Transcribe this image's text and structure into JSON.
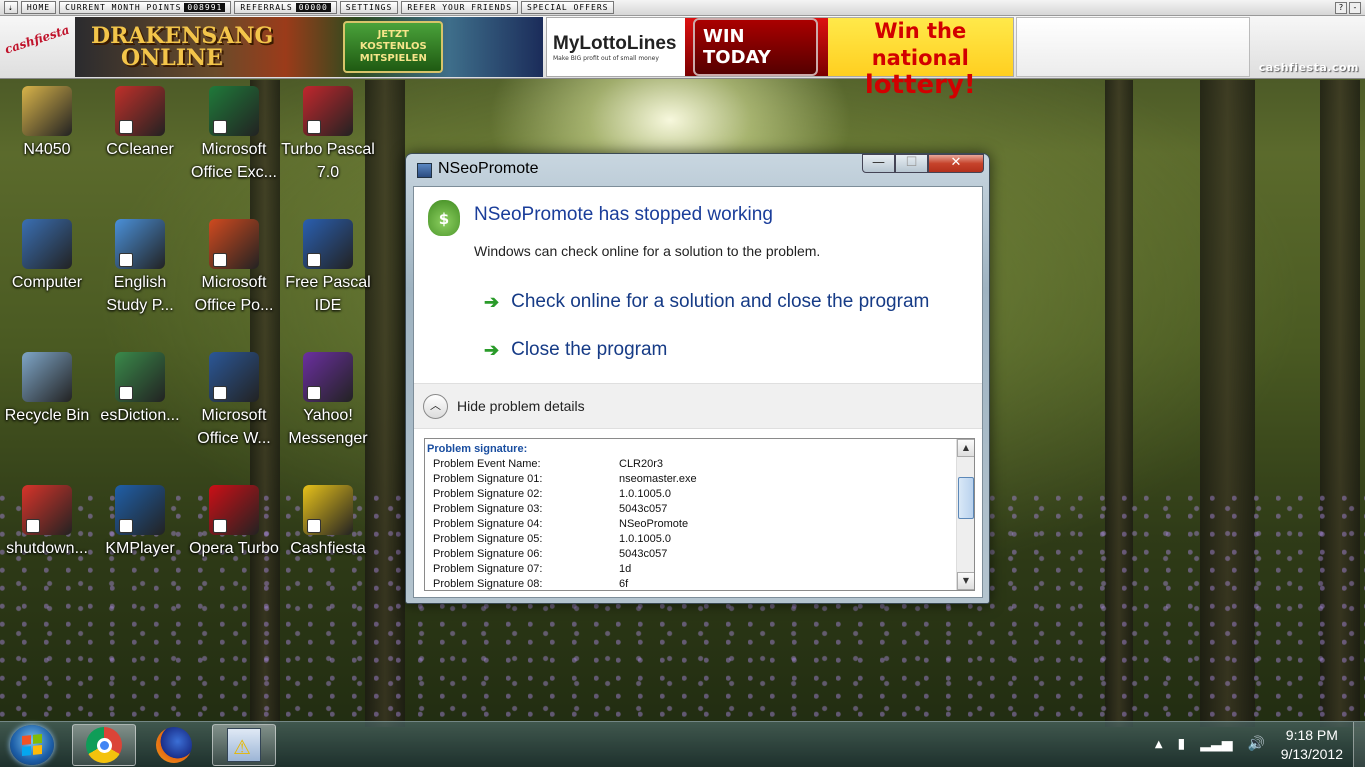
{
  "toolbar": {
    "home": "HOME",
    "month_points_label": "CURRENT MONTH POINTS",
    "month_points_value": "008991",
    "referrals_label": "REFERRALS",
    "referrals_value": "00000",
    "settings": "SETTINGS",
    "refer_friends": "REFER YOUR FRIENDS",
    "special_offers": "SPECIAL OFFERS",
    "help": "?",
    "close": "-"
  },
  "banner": {
    "logo_text": "cashfiesta",
    "ad1_title_line1": "DRAKENSANG",
    "ad1_title_line2": "ONLINE",
    "ad1_button_line1": "JETZT",
    "ad1_button_line2": "KOSTENLOS",
    "ad1_button_line3": "MITSPIELEN",
    "ad2_brand": "MyLottoLines",
    "ad2_tagline": "Make BIG profit out of small money",
    "ad2_win": "WIN TODAY",
    "ad2_lottery_line1": "Win the national",
    "ad2_lottery_line2": "lottery!",
    "site": "cashfiesta.com"
  },
  "desktop": {
    "icons": [
      {
        "label": "N4050",
        "color": "#d9b44a"
      },
      {
        "label": "CCleaner",
        "color": "#c0302a"
      },
      {
        "label": "Microsoft Office Exc...",
        "color": "#1f7a3a"
      },
      {
        "label": "Turbo Pascal 7.0",
        "color": "#c1272d"
      },
      {
        "label": "Computer",
        "color": "#3a6fb3"
      },
      {
        "label": "English Study P...",
        "color": "#4a90d9"
      },
      {
        "label": "Microsoft Office Po...",
        "color": "#d04a1f"
      },
      {
        "label": "Free Pascal IDE",
        "color": "#2a5fb0"
      },
      {
        "label": "Recycle Bin",
        "color": "#7fa6c8"
      },
      {
        "label": "esDiction...",
        "color": "#3a8a4a"
      },
      {
        "label": "Microsoft Office W...",
        "color": "#2b5797"
      },
      {
        "label": "Yahoo! Messenger",
        "color": "#6b2fa0"
      },
      {
        "label": "shutdown...",
        "color": "#d8342a"
      },
      {
        "label": "KMPlayer",
        "color": "#1f5fa8"
      },
      {
        "label": "Opera Turbo",
        "color": "#cc0f16"
      },
      {
        "label": "Cashfiesta",
        "color": "#e8c21a"
      }
    ]
  },
  "dialog": {
    "title": "NSeoPromote",
    "main_instruction": "NSeoPromote has stopped working",
    "sub_instruction": "Windows can check online for a solution to the problem.",
    "command1": "Check online for a solution and close the program",
    "command2": "Close the program",
    "details_toggle": "Hide problem details",
    "signature_header": "Problem signature:",
    "signature_rows": [
      {
        "key": "Problem Event Name:",
        "value": "CLR20r3"
      },
      {
        "key": "Problem Signature 01:",
        "value": "nseomaster.exe"
      },
      {
        "key": "Problem Signature 02:",
        "value": "1.0.1005.0"
      },
      {
        "key": "Problem Signature 03:",
        "value": "5043c057"
      },
      {
        "key": "Problem Signature 04:",
        "value": "NSeoPromote"
      },
      {
        "key": "Problem Signature 05:",
        "value": "1.0.1005.0"
      },
      {
        "key": "Problem Signature 06:",
        "value": "5043c057"
      },
      {
        "key": "Problem Signature 07:",
        "value": "1d"
      },
      {
        "key": "Problem Signature 08:",
        "value": "6f"
      }
    ],
    "btn_min": "—",
    "btn_max": "☐",
    "btn_close": "✕"
  },
  "taskbar": {
    "time": "9:18 PM",
    "date": "9/13/2012",
    "tray_up": "▲"
  }
}
